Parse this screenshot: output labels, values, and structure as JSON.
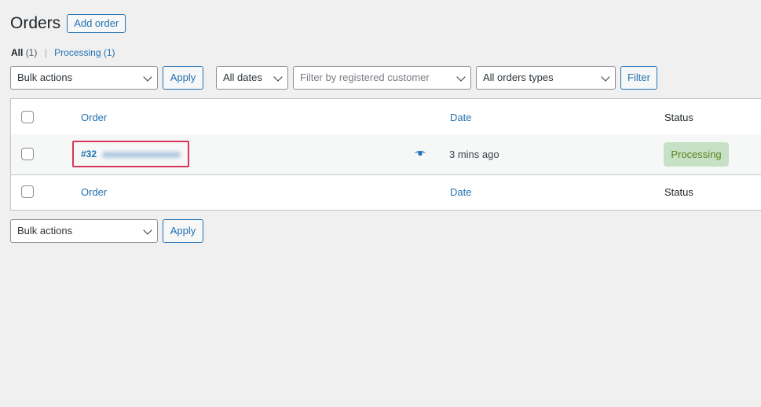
{
  "header": {
    "title": "Orders",
    "add_button": "Add order"
  },
  "views": {
    "all_label": "All",
    "all_count": "(1)",
    "processing_label": "Processing",
    "processing_count": "(1)",
    "separator": "|"
  },
  "filters": {
    "bulk_actions": "Bulk actions",
    "apply": "Apply",
    "dates": "All dates",
    "customer_placeholder": "Filter by registered customer",
    "order_types": "All orders types",
    "filter": "Filter"
  },
  "table": {
    "columns": {
      "order": "Order",
      "date": "Date",
      "status": "Status"
    },
    "rows": [
      {
        "order_number": "#32",
        "date": "3 mins ago",
        "status": "Processing"
      }
    ]
  },
  "bottom": {
    "bulk_actions": "Bulk actions",
    "apply": "Apply"
  },
  "colors": {
    "accent": "#2271b1",
    "highlight_border": "#d63659",
    "processing_bg": "#c6e1c6",
    "processing_text": "#5b841b"
  }
}
